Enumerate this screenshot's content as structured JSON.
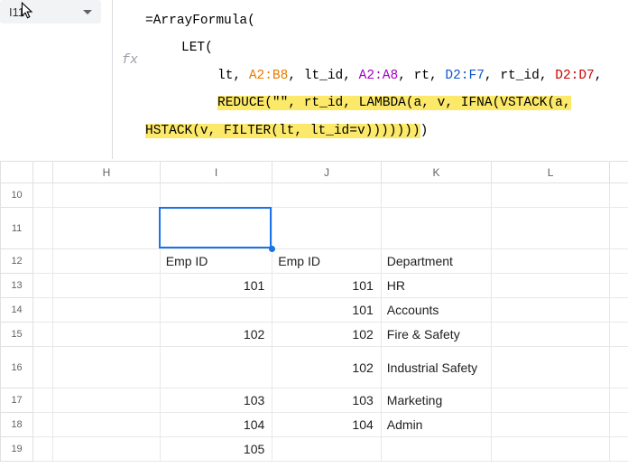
{
  "nameBox": {
    "ref": "I11"
  },
  "fx": {
    "label": "fx"
  },
  "formula": {
    "line1_pre": "=ArrayFormula(",
    "line2": "LET(",
    "line3": {
      "p1": "lt, ",
      "r1": "A2:B8",
      "p2": ", lt_id, ",
      "r2": "A2:A8",
      "p3": ", rt, ",
      "r3": "D2:F7",
      "p4": ", rt_id, ",
      "r4": "D2:D7",
      "p5": ","
    },
    "line4a": "REDUCE(\"\", rt_id, LAMBDA(a, v, IFNA(VSTACK(a,",
    "line4b": "HSTACK(v, FILTER(lt, lt_id=v)))))))",
    "line4c": ")"
  },
  "cols": [
    "",
    "H",
    "I",
    "J",
    "K",
    "L",
    ""
  ],
  "rows": [
    {
      "n": "10",
      "cells": [
        "",
        "",
        "",
        "",
        "",
        "",
        ""
      ]
    },
    {
      "n": "11",
      "active": true,
      "cells": [
        "",
        "",
        "",
        "",
        "",
        "",
        ""
      ],
      "tall": true
    },
    {
      "n": "12",
      "cells": [
        "",
        "",
        "Emp ID",
        "Emp ID",
        "Department",
        "",
        ""
      ],
      "types": [
        "",
        "",
        "txt",
        "txt",
        "txt",
        "",
        ""
      ]
    },
    {
      "n": "13",
      "cells": [
        "",
        "",
        "101",
        "101",
        "HR",
        "",
        ""
      ],
      "types": [
        "",
        "",
        "num",
        "num",
        "txt",
        "",
        ""
      ]
    },
    {
      "n": "14",
      "cells": [
        "",
        "",
        "",
        "101",
        "Accounts",
        "",
        ""
      ],
      "types": [
        "",
        "",
        "num",
        "num",
        "txt",
        "",
        ""
      ]
    },
    {
      "n": "15",
      "cells": [
        "",
        "",
        "102",
        "102",
        "Fire & Safety",
        "",
        ""
      ],
      "types": [
        "",
        "",
        "num",
        "num",
        "txt",
        "",
        ""
      ]
    },
    {
      "n": "16",
      "cells": [
        "",
        "",
        "",
        "102",
        "Industrial Safety",
        "",
        ""
      ],
      "types": [
        "",
        "",
        "num",
        "num",
        "txt",
        "",
        ""
      ],
      "tall": true
    },
    {
      "n": "17",
      "cells": [
        "",
        "",
        "103",
        "103",
        "Marketing",
        "",
        ""
      ],
      "types": [
        "",
        "",
        "num",
        "num",
        "txt",
        "",
        ""
      ]
    },
    {
      "n": "18",
      "cells": [
        "",
        "",
        "104",
        "104",
        "Admin",
        "",
        ""
      ],
      "types": [
        "",
        "",
        "num",
        "num",
        "txt",
        "",
        ""
      ]
    },
    {
      "n": "19",
      "cells": [
        "",
        "",
        "105",
        "",
        "",
        "",
        ""
      ],
      "types": [
        "",
        "",
        "num",
        "num",
        "txt",
        "",
        ""
      ]
    }
  ],
  "colClasses": [
    "col-G",
    "col-H",
    "col-I",
    "col-J",
    "col-K",
    "col-L",
    "col-E"
  ]
}
